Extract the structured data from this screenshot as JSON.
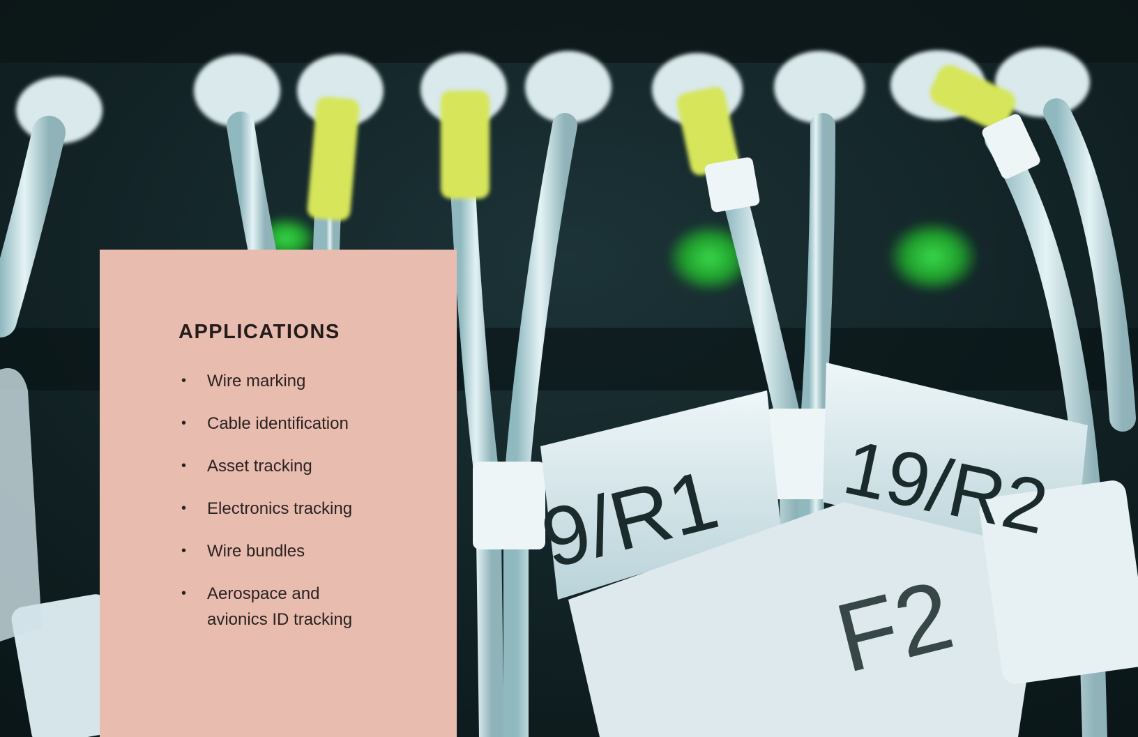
{
  "card": {
    "heading": "APPLICATIONS",
    "items": [
      "Wire marking",
      "Cable identification",
      "Asset tracking",
      "Electronics tracking",
      "Wire bundles",
      "Aerospace and avionics ID tracking"
    ],
    "background_color": "#e8bcae"
  },
  "photo": {
    "labels": [
      "9/R1",
      "19/R2",
      "F2"
    ],
    "colors": {
      "cable": "#c9e2e6",
      "sleeve": "#d6e55a",
      "led": "#29c63a",
      "panel": "#0e1c1f"
    }
  }
}
